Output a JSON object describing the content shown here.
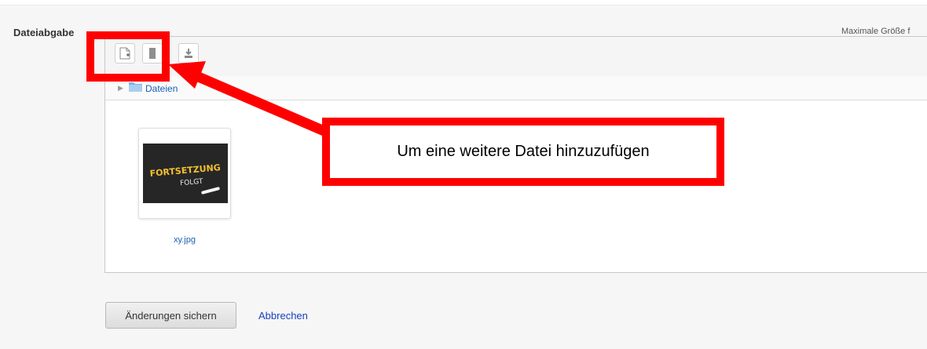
{
  "section_label": "Dateiabgabe",
  "max_size_text": "Maximale Größe f",
  "toolbar": {
    "add_file_icon": "file-add-icon",
    "folder_icon": "folder-create-icon",
    "download_icon": "download-icon"
  },
  "path": {
    "folder_label": "Dateien"
  },
  "files": [
    {
      "name": "xy.jpg",
      "thumbnail_text_line1": "FORTSETZUNG",
      "thumbnail_text_line2": "FOLGT"
    }
  ],
  "actions": {
    "save_label": "Änderungen sichern",
    "cancel_label": "Abbrechen"
  },
  "annotation": {
    "callout_text": "Um eine weitere Datei hinzuzufügen",
    "color": "#ff0000"
  },
  "colors": {
    "link": "#1a5fb4",
    "background": "#f6f6f6"
  }
}
